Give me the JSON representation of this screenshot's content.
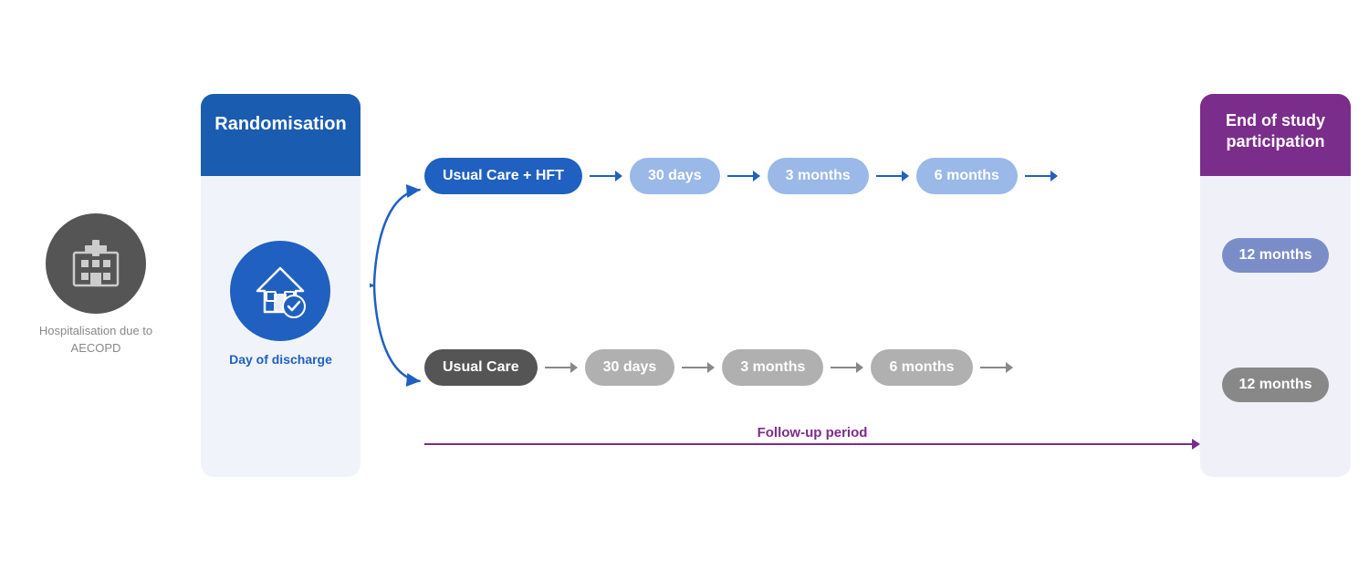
{
  "hospital": {
    "label": "Hospitalisation due to AECOPD"
  },
  "randomisation": {
    "title": "Randomisation",
    "discharge_label": "Day of discharge"
  },
  "end": {
    "title": "End of study participation"
  },
  "top_arm": {
    "label": "Usual Care + HFT",
    "steps": [
      "30 days",
      "3 months",
      "6 months",
      "12 months"
    ]
  },
  "bottom_arm": {
    "label": "Usual Care",
    "steps": [
      "30 days",
      "3 months",
      "6 months",
      "12 months"
    ]
  },
  "followup": {
    "label": "Follow-up period"
  },
  "colors": {
    "blue_dark": "#2060c0",
    "blue_light": "#7b9fd8",
    "blue_pill_12": "#7b8dc8",
    "gray_dark": "#555555",
    "gray_light": "#a0a0a0",
    "purple": "#7b2d8b"
  }
}
